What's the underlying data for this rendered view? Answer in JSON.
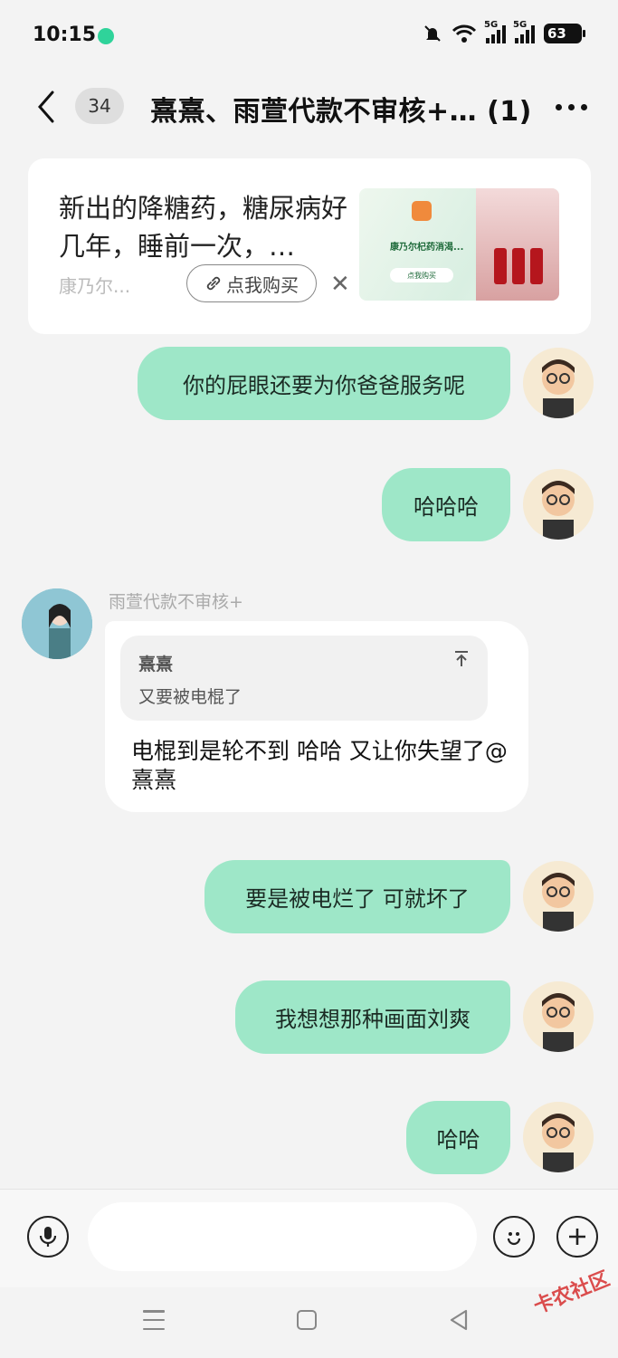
{
  "status_bar": {
    "time": "10:15",
    "network1": "5G",
    "network2": "5G",
    "battery": "63"
  },
  "header": {
    "unread_count": "34",
    "title": "熹熹、雨萱代款不审核+…  (1)"
  },
  "ad": {
    "text": "新出的降糖药，糖尿病好几年，睡前一次，…",
    "brand": "康乃尔...",
    "buy_label": "点我购买",
    "image_title": "康乃尔杞药消渴...",
    "image_button": "点我购买"
  },
  "messages": {
    "m1": "你的屁眼还要为你爸爸服务呢",
    "m2": "哈哈哈",
    "sender": "雨萱代款不审核+",
    "quote_name": "熹熹",
    "quote_text": "又要被电棍了",
    "reply": "电棍到是轮不到 哈哈 又让你失望了@熹熹",
    "m3": "要是被电烂了 可就坏了",
    "m4": "我想想那种画面刘爽",
    "m5": "哈哈"
  },
  "watermark": "卡农社区",
  "colors": {
    "my_bubble": "#9ee7c8",
    "background": "#f3f3f3"
  }
}
